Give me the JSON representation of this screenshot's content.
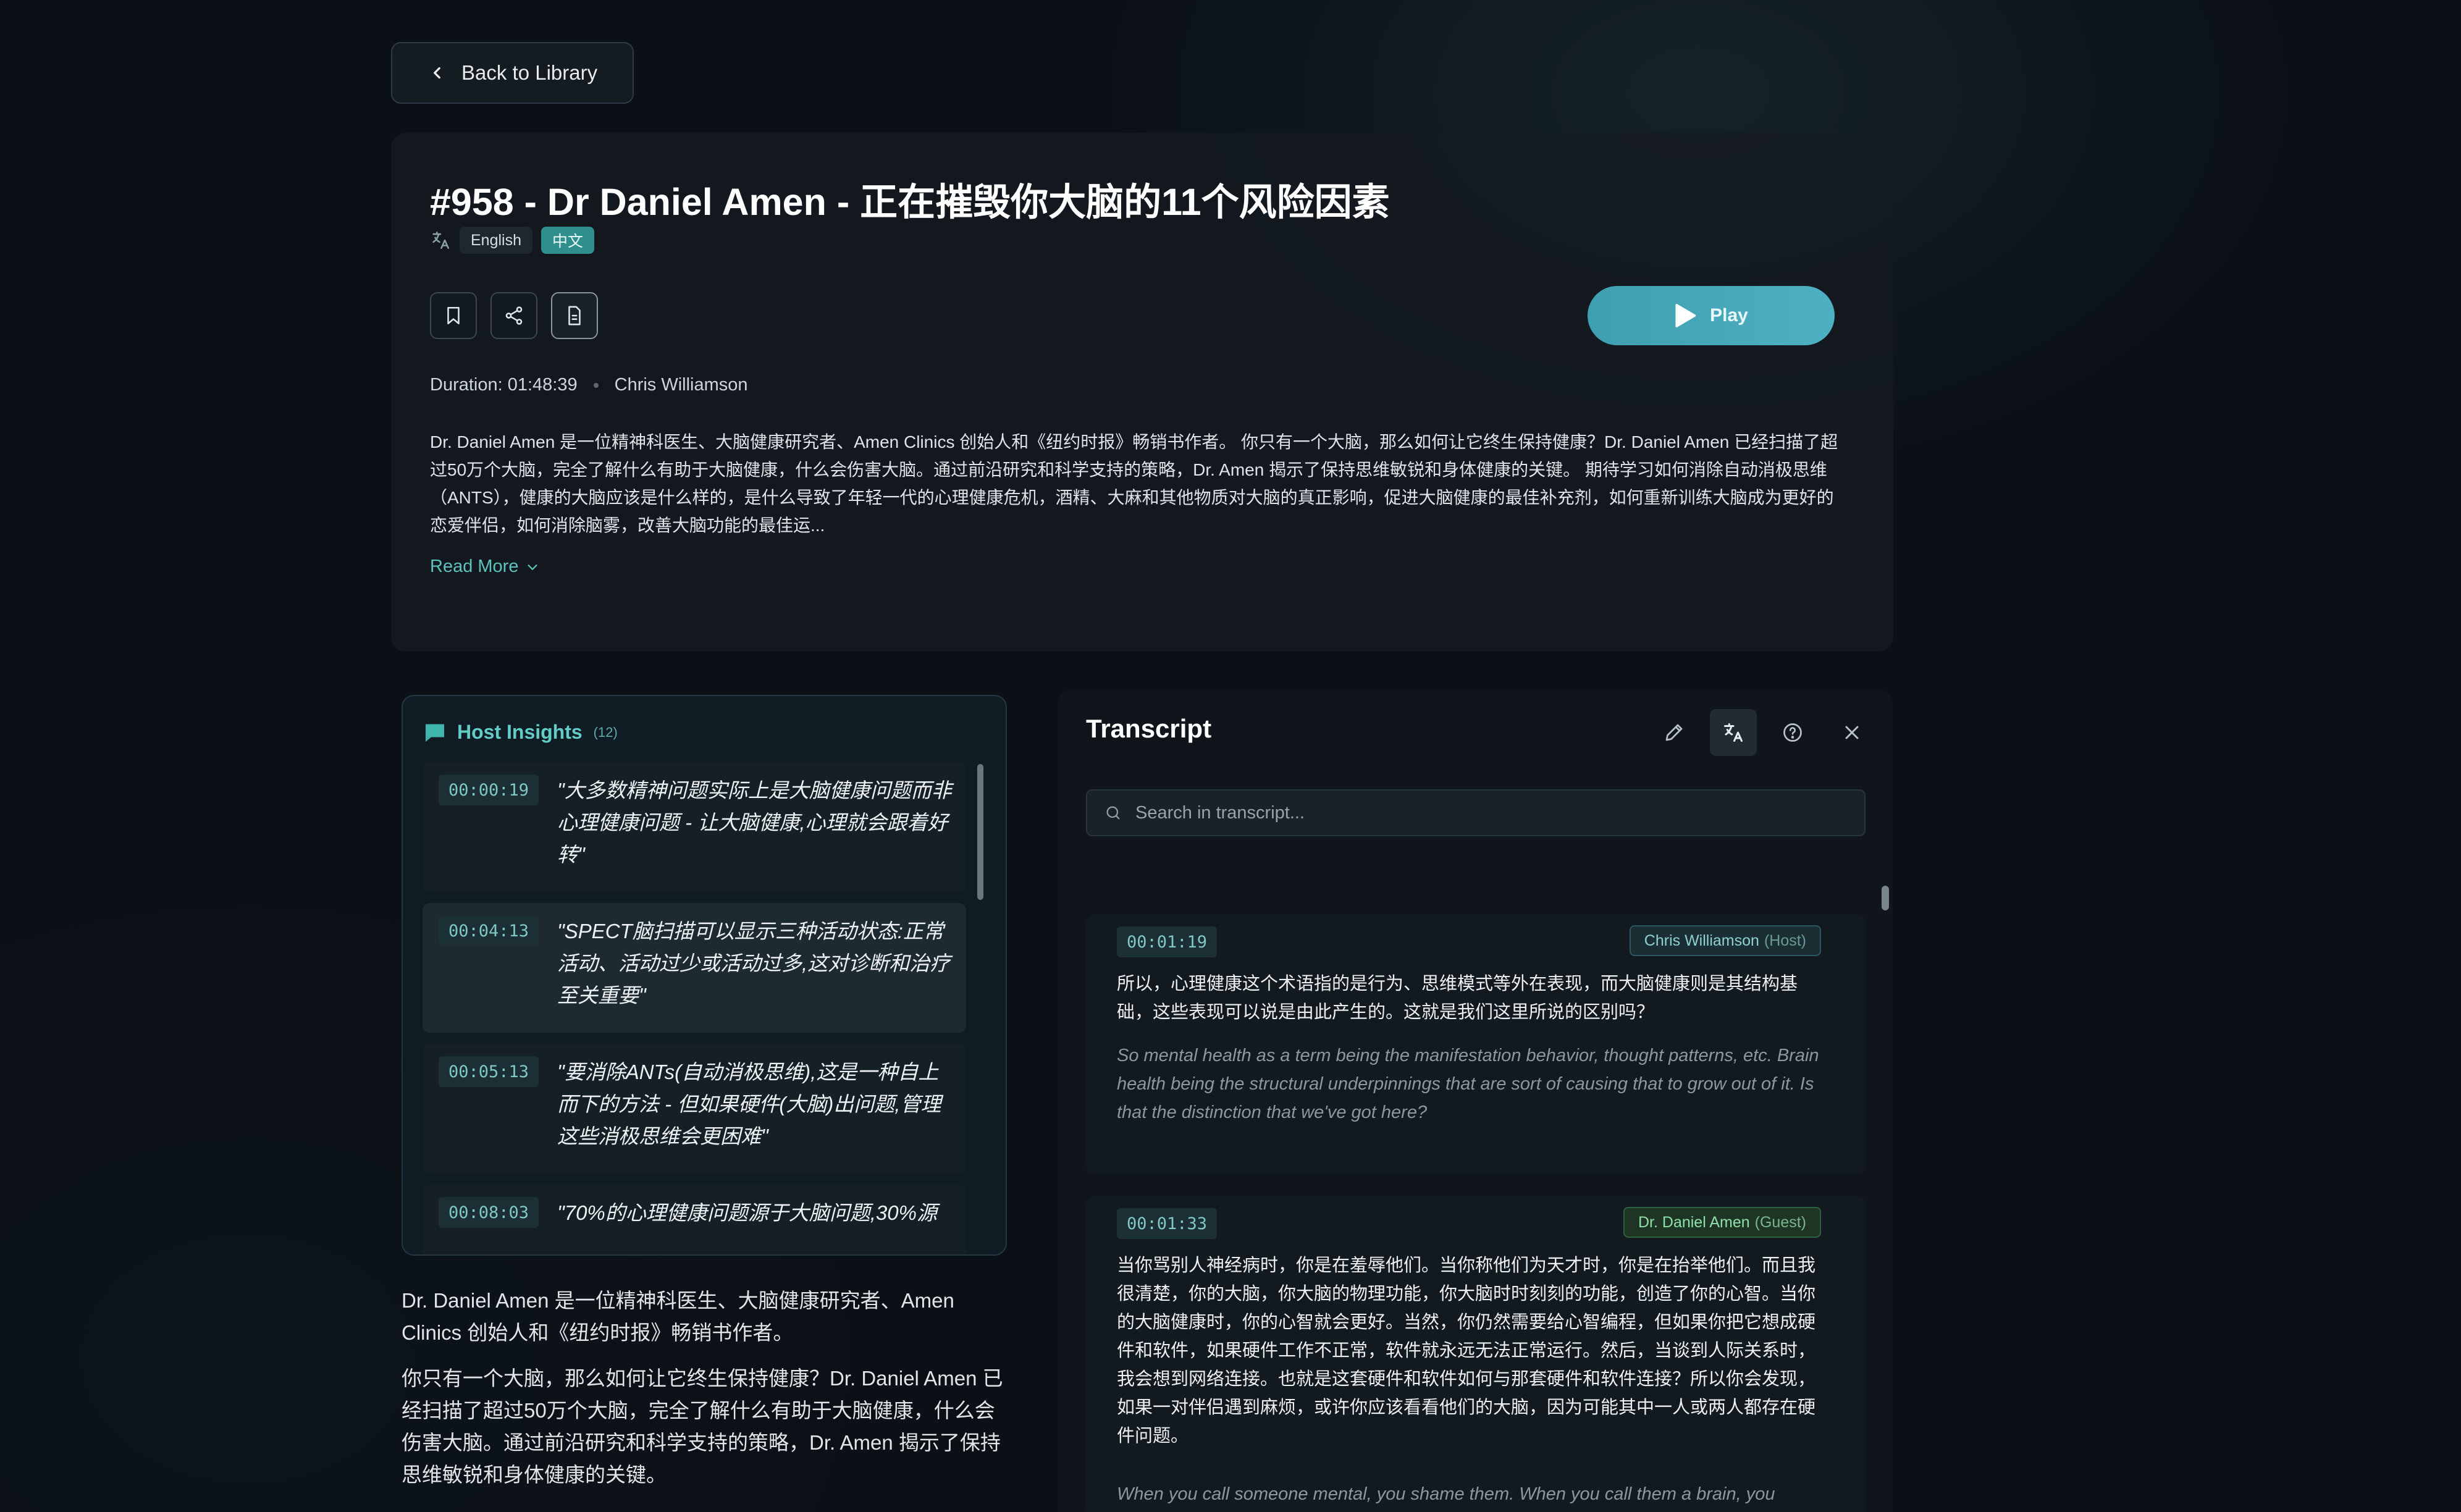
{
  "nav": {
    "back_label": "Back to Library"
  },
  "episode": {
    "title": "#958 - Dr Daniel Amen - 正在摧毁你大脑的11个风险因素",
    "languages": [
      "English",
      "中文"
    ],
    "active_language": "中文",
    "duration": "Duration: 01:48:39",
    "host": "Chris Williamson",
    "play_label": "Play",
    "description": "Dr. Daniel Amen 是一位精神科医生、大脑健康研究者、Amen Clinics 创始人和《纽约时报》畅销书作者。 你只有一个大脑，那么如何让它终生保持健康？Dr. Daniel Amen 已经扫描了超过50万个大脑，完全了解什么有助于大脑健康，什么会伤害大脑。通过前沿研究和科学支持的策略，Dr. Amen 揭示了保持思维敏锐和身体健康的关键。 期待学习如何消除自动消极思维（ANTS），健康的大脑应该是什么样的，是什么导致了年轻一代的心理健康危机，酒精、大麻和其他物质对大脑的真正影响，促进大脑健康的最佳补充剂，如何重新训练大脑成为更好的恋爱伴侣，如何消除脑雾，改善大脑功能的最佳运...",
    "read_more_label": "Read More"
  },
  "insights": {
    "title": "Host Insights",
    "count": "(12)",
    "items": [
      {
        "time": "00:00:19",
        "quote": "\"大多数精神问题实际上是大脑健康问题而非心理健康问题 - 让大脑健康,心理就会跟着好转\""
      },
      {
        "time": "00:04:13",
        "quote": "\"SPECT脑扫描可以显示三种活动状态:正常活动、活动过少或活动过多,这对诊断和治疗至关重要\""
      },
      {
        "time": "00:05:13",
        "quote": "\"要消除ANTs(自动消极思维),这是一种自上而下的方法 - 但如果硬件(大脑)出问题,管理这些消极思维会更困难\""
      },
      {
        "time": "00:08:03",
        "quote": "\"70%的心理健康问题源于大脑问题,30%源"
      }
    ]
  },
  "summary": {
    "paragraphs": [
      "Dr. Daniel Amen 是一位精神科医生、大脑健康研究者、Amen Clinics 创始人和《纽约时报》畅销书作者。",
      "你只有一个大脑，那么如何让它终生保持健康？Dr. Daniel Amen 已经扫描了超过50万个大脑，完全了解什么有助于大脑健康，什么会伤害大脑。通过前沿研究和科学支持的策略，Dr. Amen 揭示了保持思维敏锐和身体健康的关键。"
    ]
  },
  "transcript": {
    "title": "Transcript",
    "search_placeholder": "Search in transcript...",
    "segments": [
      {
        "time": "00:01:19",
        "speaker": "Chris Williamson",
        "role": "(Host)",
        "zh": "所以，心理健康这个术语指的是行为、思维模式等外在表现，而大脑健康则是其结构基础，这些表现可以说是由此产生的。这就是我们这里所说的区别吗？",
        "en": "So mental health as a term being the manifestation behavior, thought patterns, etc. Brain health being the structural underpinnings that are sort of causing that to grow out of it. Is that the distinction that we've got here?"
      },
      {
        "time": "00:01:33",
        "speaker": "Dr. Daniel Amen",
        "role": "(Guest)",
        "zh": "当你骂别人神经病时，你是在羞辱他们。当你称他们为天才时，你是在抬举他们。而且我很清楚，你的大脑，你大脑的物理功能，你大脑时时刻刻的功能，创造了你的心智。当你的大脑健康时，你的心智就会更好。当然，你仍然需要给心智编程，但如果你把它想成硬件和软件，如果硬件工作不正常，软件就永远无法正常运行。然后，当谈到人际关系时，我会想到网络连接。也就是这套硬件和软件如何与那套硬件和软件连接？所以你会发现，如果一对伴侣遇到麻烦，或许你应该看看他们的大脑，因为可能其中一人或两人都存在硬件问题。",
        "en": "When you call someone mental, you shame them. When you call them a brain, you elevate them. And it's very clear to me that your brain, the physical functioning of"
      }
    ]
  },
  "colors": {
    "accent": "#5cc3bf",
    "play_start": "#3f9fb0",
    "play_end": "#4db0c3",
    "guest_badge": "#8fe0a6"
  }
}
